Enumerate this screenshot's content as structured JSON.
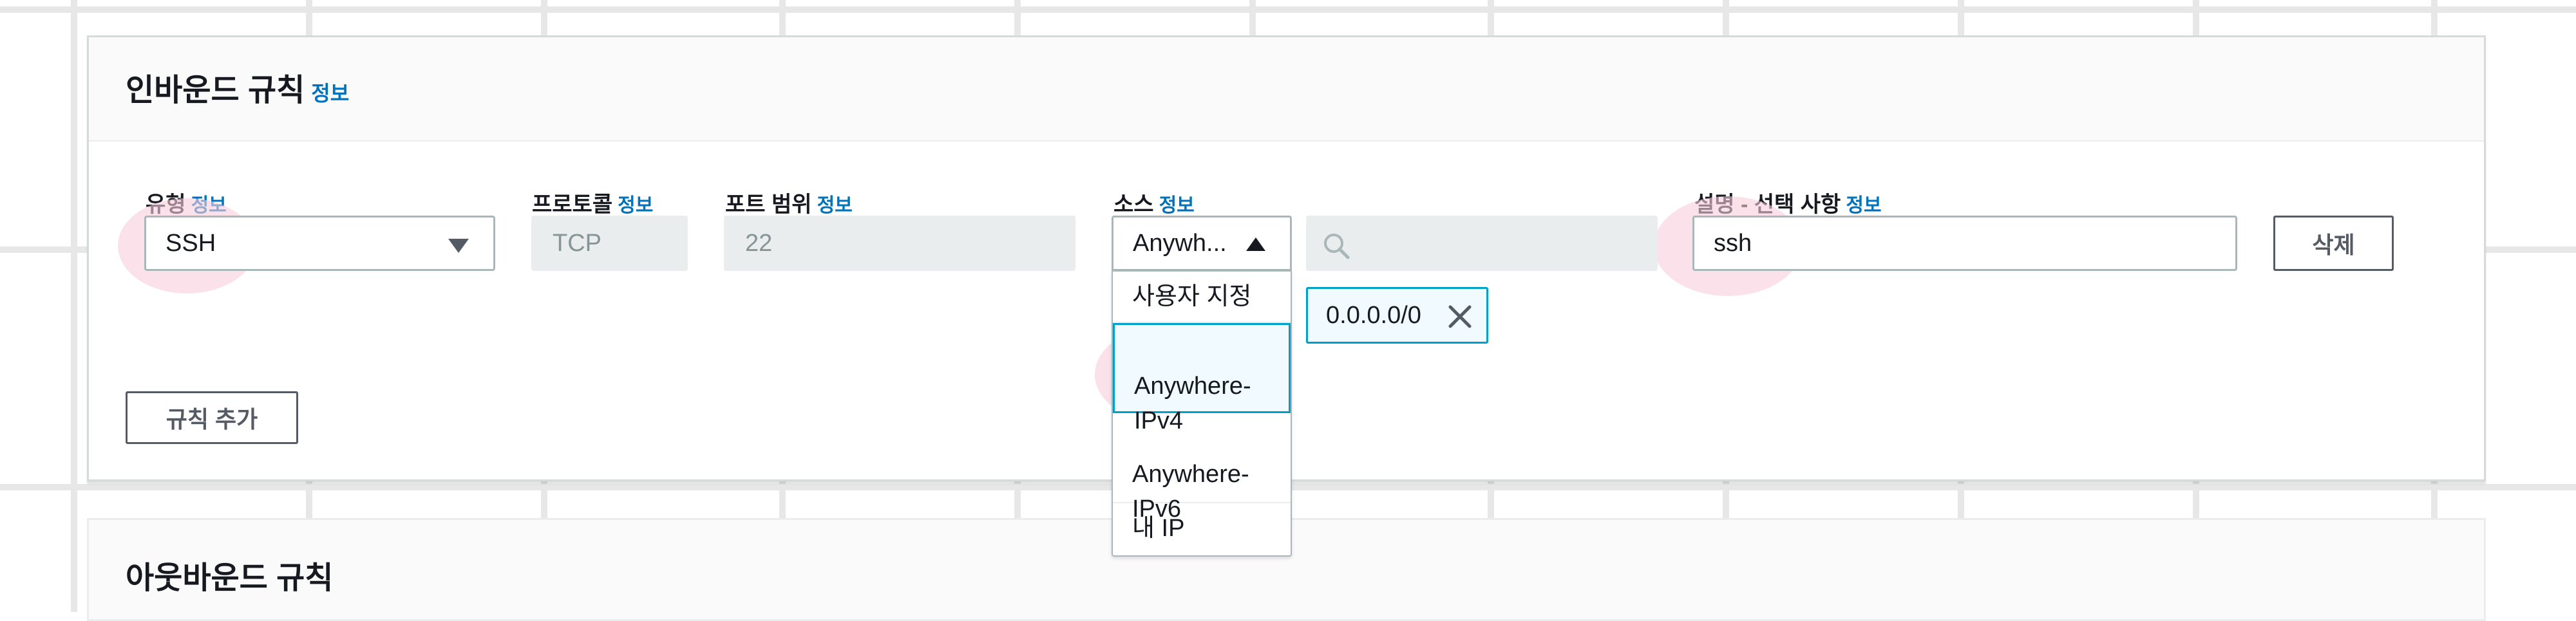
{
  "inbound_rules": {
    "title": "인바운드 규칙",
    "info": "정보",
    "columns": {
      "type": {
        "label": "유형",
        "info": "정보"
      },
      "protocol": {
        "label": "프로토콜",
        "info": "정보"
      },
      "port_range": {
        "label": "포트 범위",
        "info": "정보"
      },
      "source": {
        "label": "소스",
        "info": "정보"
      },
      "description": {
        "label": "설명 - 선택 사항",
        "info": "정보"
      }
    },
    "rule": {
      "type_value": "SSH",
      "protocol_value": "TCP",
      "port_value": "22",
      "source_value": "Anywh...",
      "source_search_placeholder": "",
      "source_token": "0.0.0.0/0",
      "description_value": "ssh",
      "delete_label": "삭제"
    },
    "source_options": [
      {
        "label": "사용자 지정",
        "selected": false
      },
      {
        "label": "Anywhere-\nIPv4",
        "selected": true
      },
      {
        "label": "Anywhere-\nIPv6",
        "selected": false
      },
      {
        "label": "내 IP",
        "selected": false
      }
    ],
    "add_rule_label": "규칙 추가"
  },
  "outbound_rules": {
    "title": "아웃바운드 규칙"
  },
  "colors": {
    "link": "#0073bb",
    "selected_border": "#00a1c9",
    "selected_bg": "#f1faff",
    "highlight": "#f7cddc"
  },
  "icons": [
    "caret-down-icon",
    "caret-up-icon",
    "search-icon",
    "close-icon"
  ]
}
